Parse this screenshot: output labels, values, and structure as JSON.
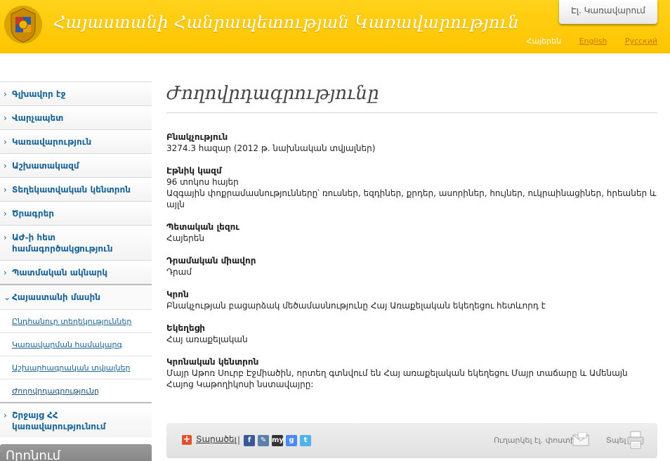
{
  "header": {
    "site_title": "Հայաստանի Հանրապետության Կառավարություն",
    "egov_button": "Էլ. Կառավարում",
    "languages": [
      {
        "label": "Հայերեն"
      },
      {
        "label": "English"
      },
      {
        "label": "Русский"
      }
    ]
  },
  "sidebar": {
    "items": [
      {
        "label": "Գլխավոր էջ"
      },
      {
        "label": "Վարչապետ"
      },
      {
        "label": "Կառավարություն"
      },
      {
        "label": "Աշխատակազմ"
      },
      {
        "label": "Տեղեկատվական կենտրոն"
      },
      {
        "label": "Ծրագրեր"
      },
      {
        "label": "ԱԺ-ի հետ համագործակցություն"
      },
      {
        "label": "Պատմական ակնարկ"
      },
      {
        "label": "Հայաստանի մասին"
      }
    ],
    "subitems": [
      {
        "label": "Ընդհանուր տեղեկություններ"
      },
      {
        "label": "Կառավարման համակարգ"
      },
      {
        "label": "Աշխարհագրական տվյալներ"
      },
      {
        "label": "Ժողովրդագրությունը"
      }
    ],
    "after_item": {
      "label": "Շրջայց ՀՀ կառավարությունում"
    },
    "box_title": "Որոնում"
  },
  "main": {
    "title": "Ժողովրդագրությունը",
    "sections": [
      {
        "heading": "Բնակչություն",
        "text": "3274.3 հազար (2012 թ. նախնական տվյալներ)"
      },
      {
        "heading": "Էթնիկ կազմ",
        "lines": [
          "96 տոկոս հայեր",
          "Ազգային փոքրամասնությունները՝ ռուսներ, եզդիներ, քրդեր, ասորիներ, հույներ, ուկրաինացիներ, հրեաներ և այլն"
        ]
      },
      {
        "heading": "Պետական լեզու",
        "text": "Հայերեն"
      },
      {
        "heading": "Դրամական միավոր",
        "text": "Դրամ"
      },
      {
        "heading": "Կրոն",
        "text": "Բնակչության բացարձակ մեծամասնությունը Հայ Առաքելական եկեղեցու հետևորդ է"
      },
      {
        "heading": "Եկեղեցի",
        "text": "Հայ առաքելական"
      },
      {
        "heading": "Կրոնական կենտրոն",
        "text": "Մայր Աթոռ Սուրբ Էջմիածին, որտեղ գտնվում են Հայ առաքելական եկեղեցու Մայր տաճարը և Ամենայն Հայոց Կաթողիկոսի նստավայրը:"
      }
    ]
  },
  "share_bar": {
    "share_label": "Տարածել",
    "separator": "|",
    "social": [
      {
        "icon": "facebook-icon",
        "glyph": "f",
        "color": "#3b5998"
      },
      {
        "icon": "pencil-icon",
        "glyph": "✎",
        "color": "#5a7fa8"
      },
      {
        "icon": "myspace-icon",
        "glyph": "my",
        "color": "#333333"
      },
      {
        "icon": "google-icon",
        "glyph": "g",
        "color": "#4a8af4"
      },
      {
        "icon": "twitter-icon",
        "glyph": "t",
        "color": "#4fb3e8"
      }
    ],
    "send_email_label": "Ուղարկել էլ. փոստին",
    "print_label": "Տպել"
  },
  "colors": {
    "header_yellow": "#ffc400",
    "link_blue": "#1a6496",
    "lang_link": "#c27b00"
  }
}
